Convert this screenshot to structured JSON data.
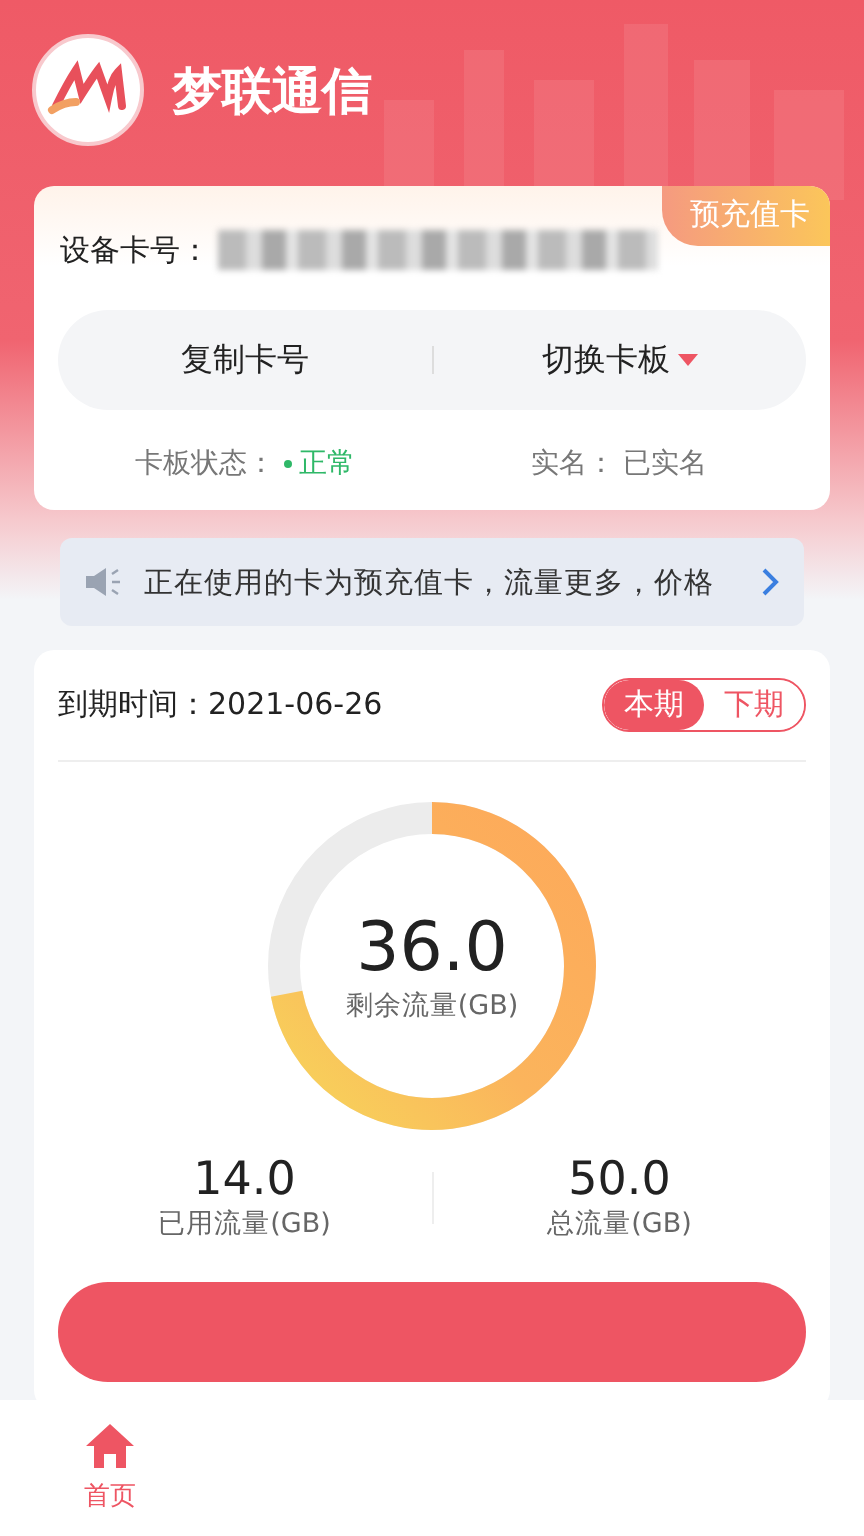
{
  "app": {
    "title": "梦联通信"
  },
  "card": {
    "badge": "预充值卡",
    "number_label": "设备卡号：",
    "actions": [
      {
        "label": "复制卡号",
        "dropdown": false
      },
      {
        "label": "切换卡板",
        "dropdown": true
      }
    ],
    "status": [
      {
        "label": "卡板状态：",
        "value": "正常",
        "color": "#2fb868"
      },
      {
        "label": "实名：",
        "value": "已实名"
      }
    ]
  },
  "notice": {
    "text": "正在使用的卡为预充值卡，流量更多，价格"
  },
  "usage": {
    "expiry_label": "到期时间：",
    "expiry_date": "2021-06-26",
    "periods": [
      {
        "label": "本期",
        "selected": true
      },
      {
        "label": "下期",
        "selected": false
      }
    ],
    "remaining": {
      "value": "36.0",
      "label": "剩余流量(GB)"
    },
    "stats": [
      {
        "value": "14.0",
        "label": "已用流量(GB)"
      },
      {
        "value": "50.0",
        "label": "总流量(GB)"
      }
    ]
  },
  "tab_bar": [
    {
      "label": "首页",
      "selected": true
    }
  ]
}
